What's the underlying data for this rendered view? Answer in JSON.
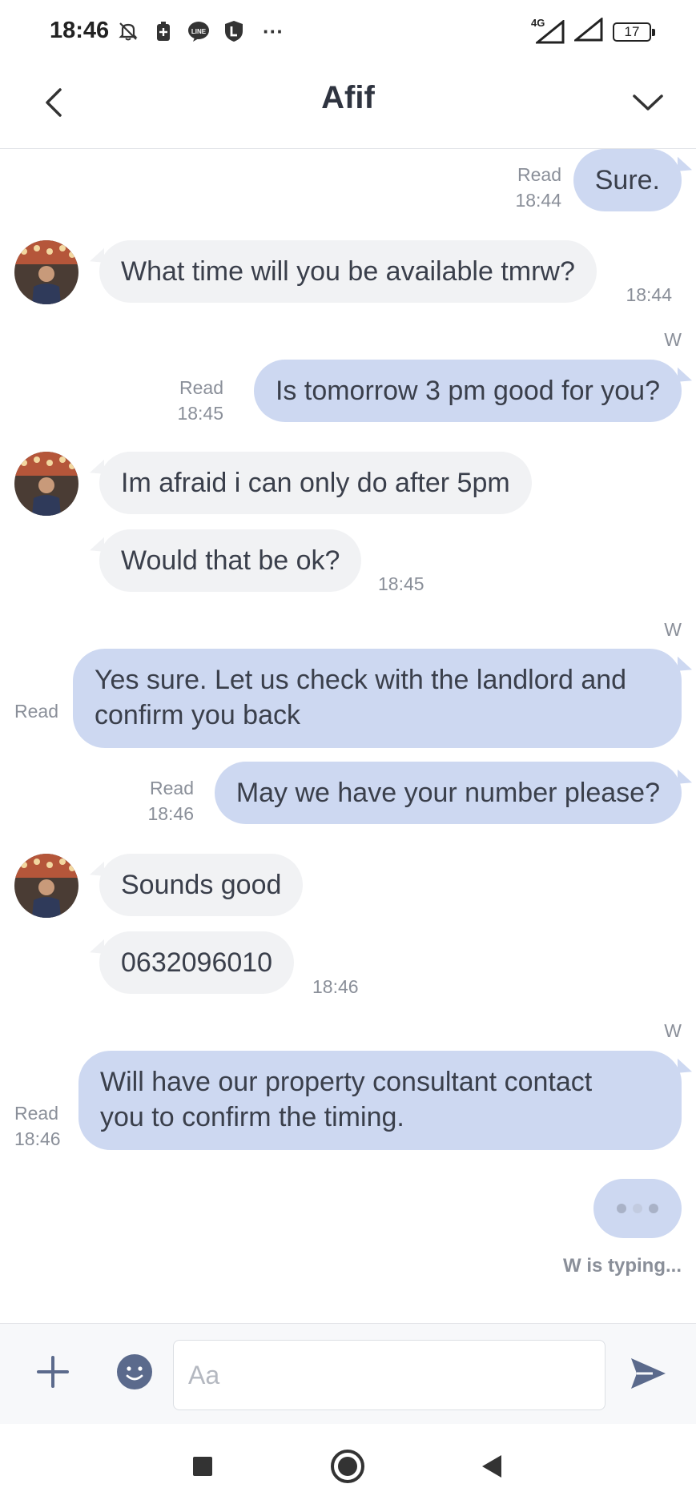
{
  "status_bar": {
    "time": "18:46",
    "network_label": "4G",
    "battery_level": "17",
    "more_glyph": "···"
  },
  "header": {
    "title": "Afif"
  },
  "messages": [
    {
      "id": "m1",
      "direction": "out",
      "text": "Sure.",
      "read_label": "Read",
      "time": "18:44"
    },
    {
      "id": "m2",
      "direction": "in",
      "text": "What time will you be available tmrw?",
      "time": "18:44"
    },
    {
      "id": "m3",
      "direction": "out",
      "sender": "W",
      "text": "Is tomorrow 3 pm good for you?",
      "read_label": "Read",
      "time": "18:45"
    },
    {
      "id": "m4",
      "direction": "in",
      "text": "Im afraid i can only do after 5pm"
    },
    {
      "id": "m5",
      "direction": "in",
      "text": "Would that be ok?",
      "time": "18:45"
    },
    {
      "id": "m6",
      "direction": "out",
      "sender": "W",
      "text_line1": "Yes sure. Let us check with the landlord and",
      "text_line2": "confirm you back",
      "read_label": "Read"
    },
    {
      "id": "m7",
      "direction": "out",
      "text": "May we have your number please?",
      "read_label": "Read",
      "time": "18:46"
    },
    {
      "id": "m8",
      "direction": "in",
      "text": "Sounds good"
    },
    {
      "id": "m9",
      "direction": "in",
      "text": "0632096010",
      "time": "18:46"
    },
    {
      "id": "m10",
      "direction": "out",
      "sender": "W",
      "text_line1": "Will have our property consultant contact",
      "text_line2": "you to confirm the timing.",
      "read_label": "Read",
      "time": "18:46"
    }
  ],
  "typing": {
    "label": "W is typing..."
  },
  "input": {
    "placeholder": "Aa"
  },
  "colors": {
    "outgoing_bubble": "#cdd8f1",
    "incoming_bubble": "#f1f2f4",
    "accent_icon": "#5b6a8c"
  },
  "icons": {
    "back": "chevron-left-icon",
    "menu": "chevron-down-icon",
    "add": "plus-icon",
    "emoji": "smiley-icon",
    "send": "send-icon",
    "nav_recents": "square-icon",
    "nav_home": "circle-icon",
    "nav_back": "triangle-back-icon"
  }
}
